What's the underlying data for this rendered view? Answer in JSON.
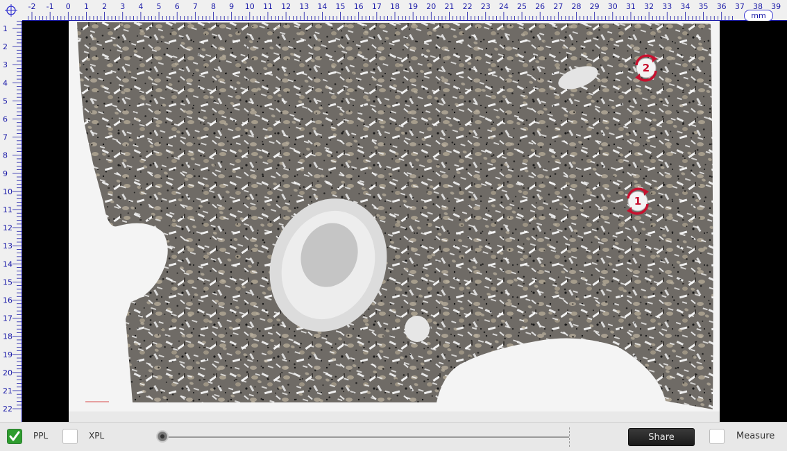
{
  "ruler": {
    "unit": "mm",
    "top_ticks": [
      "-2",
      "-1",
      "0",
      "1",
      "2",
      "3",
      "4",
      "5",
      "6",
      "7",
      "8",
      "9",
      "10",
      "11",
      "12",
      "13",
      "14",
      "15",
      "16",
      "17",
      "18",
      "19",
      "20",
      "21",
      "22",
      "23",
      "24",
      "25",
      "26",
      "27",
      "28",
      "29",
      "30",
      "31",
      "32",
      "33",
      "34",
      "35",
      "36",
      "37",
      "38",
      "39"
    ],
    "left_ticks": [
      "1",
      "2",
      "3",
      "4",
      "5",
      "6",
      "7",
      "8",
      "9",
      "10",
      "11",
      "12",
      "13",
      "14",
      "15",
      "16",
      "17",
      "18",
      "19",
      "20",
      "21",
      "22"
    ]
  },
  "hotspots": [
    {
      "label": "2"
    },
    {
      "label": "1"
    }
  ],
  "toolbar": {
    "ppl_label": "PPL",
    "ppl_checked": true,
    "xpl_label": "XPL",
    "xpl_checked": false,
    "share_label": "Share",
    "measure_label": "Measure",
    "measure_checked": false
  },
  "colors": {
    "ruler_text": "#1a1aa8",
    "hotspot_arrow": "#c8102e",
    "check": "#2e9d2e"
  }
}
